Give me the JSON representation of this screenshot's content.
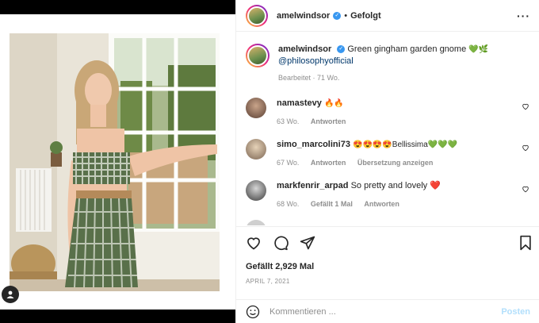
{
  "post": {
    "username": "amelwindsor",
    "follow_status": "Gefolgt",
    "more_icon": "more-horizontal-icon",
    "caption_text": "Green gingham garden gnome",
    "caption_emojis": "💚🌿",
    "caption_mention": "@philosophyofficial",
    "caption_meta": "Bearbeitet · 71 Wo."
  },
  "comments": [
    {
      "username": "namastevy",
      "text": "🔥🔥",
      "age": "63 Wo.",
      "reply": "Antworten",
      "extra": ""
    },
    {
      "username": "simo_marcolini73",
      "text": "😍😍😍😍Bellissima💚💚💚",
      "age": "67 Wo.",
      "reply": "Antworten",
      "extra": "Übersetzung anzeigen"
    },
    {
      "username": "markfenrir_arpad",
      "text": "So pretty and lovely ❤️",
      "age": "68 Wo.",
      "likes": "Gefällt 1 Mal",
      "reply": "Antworten"
    }
  ],
  "actions": {
    "likes": "Gefällt 2,929 Mal",
    "date": "APRIL 7, 2021"
  },
  "composer": {
    "placeholder": "Kommentieren ...",
    "post_label": "Posten"
  },
  "colors": {
    "verified": "#3897f0",
    "muted": "#8e8e8e",
    "post_disabled": "#b2dffc"
  }
}
